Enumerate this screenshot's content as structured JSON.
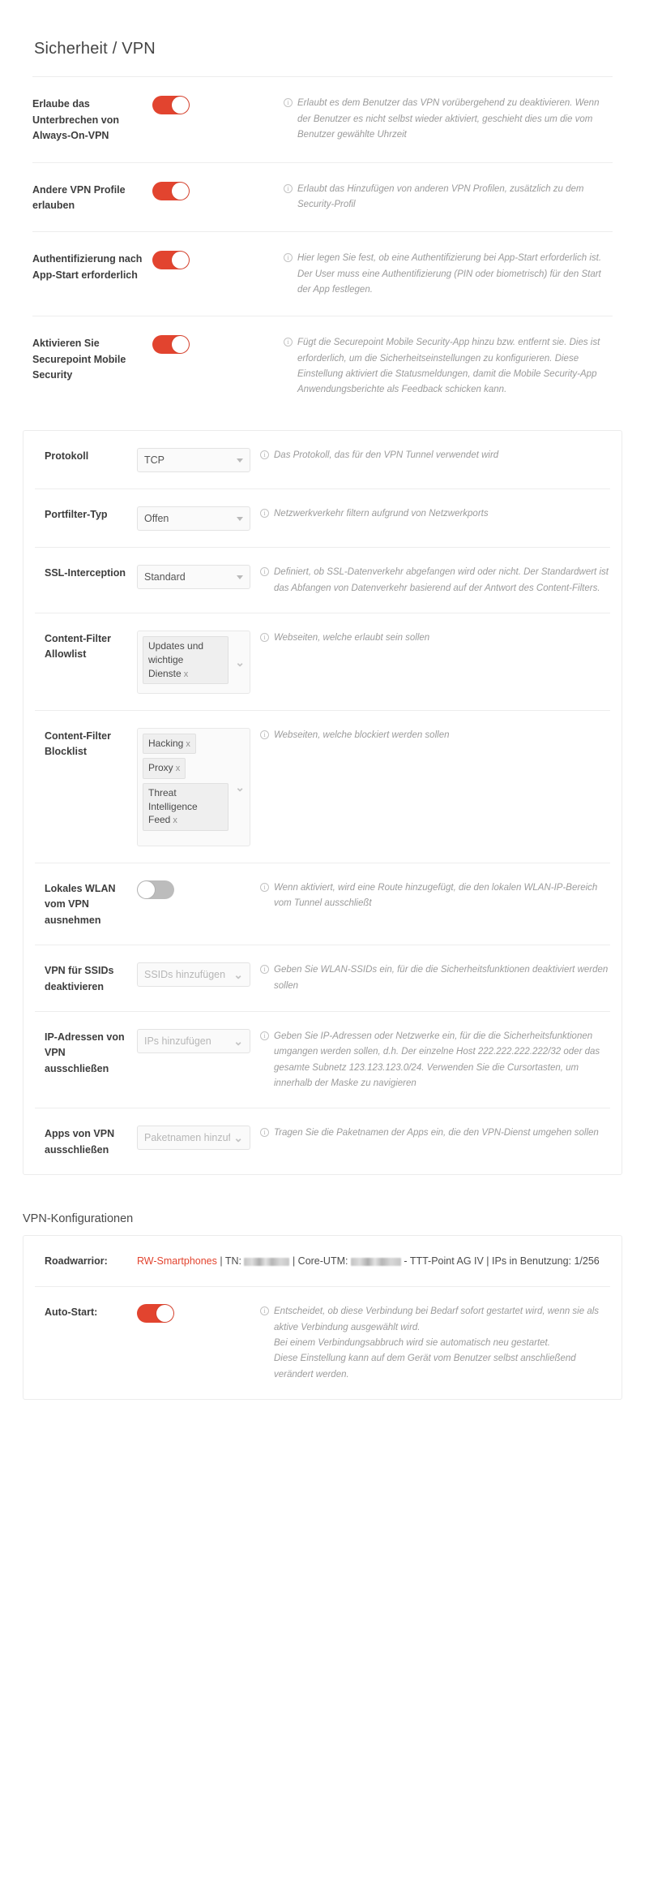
{
  "page": {
    "title": "Sicherheit / VPN"
  },
  "colors": {
    "accent": "#e2442f",
    "toggle_on": "#e2442f",
    "toggle_off": "#bcbcbc",
    "help_text": "#9b9b9b",
    "label_text": "#3d3d3d"
  },
  "toggle_rows": [
    {
      "label": "Erlaube das Unterbrechen von Always-On-VPN",
      "state": "on",
      "help": "Erlaubt es dem Benutzer das VPN vorübergehend zu deaktivieren. Wenn der Benutzer es nicht selbst wieder aktiviert, geschieht dies um die vom Benutzer gewählte Uhrzeit"
    },
    {
      "label": "Andere VPN Profile erlauben",
      "state": "on",
      "help": "Erlaubt das Hinzufügen von anderen VPN Profilen, zusätzlich zu dem Security-Profil"
    },
    {
      "label": "Authentifizierung nach App-Start erforderlich",
      "state": "on",
      "help": "Hier legen Sie fest, ob eine Authentifizierung bei App-Start erforderlich ist. Der User muss eine Authentifizierung (PIN oder biometrisch) für den Start der App festlegen."
    },
    {
      "label": "Aktivieren Sie Securepoint Mobile Security",
      "state": "on",
      "help": "Fügt die Securepoint Mobile Security-App hinzu bzw. entfernt sie. Dies ist erforderlich, um die Sicherheitseinstellungen zu konfigurieren. Diese Einstellung aktiviert die Statusmeldungen, damit die Mobile Security-App Anwendungsberichte als Feedback schicken kann."
    }
  ],
  "settings_card": {
    "protokoll": {
      "label": "Protokoll",
      "value": "TCP",
      "help": "Das Protokoll, das für den VPN Tunnel verwendet wird"
    },
    "portfilter": {
      "label": "Portfilter-Typ",
      "value": "Offen",
      "help": "Netzwerkverkehr filtern aufgrund von Netzwerkports"
    },
    "ssl": {
      "label": "SSL-Interception",
      "value": "Standard",
      "help": "Definiert, ob SSL-Datenverkehr abgefangen wird oder nicht. Der Standardwert ist das Abfangen von Datenverkehr basierend auf der Antwort des Content-Filters."
    },
    "allowlist": {
      "label": "Content-Filter Allowlist",
      "chips": [
        "Updates und wichtige Dienste"
      ],
      "help": "Webseiten, welche erlaubt sein sollen"
    },
    "blocklist": {
      "label": "Content-Filter Blocklist",
      "chips": [
        "Hacking",
        "Proxy",
        "Threat Intelligence Feed"
      ],
      "help": "Webseiten, welche blockiert werden sollen"
    },
    "wlan": {
      "label": "Lokales WLAN vom VPN ausnehmen",
      "state": "off",
      "help": "Wenn aktiviert, wird eine Route hinzugefügt, die den lokalen WLAN-IP-Bereich vom Tunnel ausschließt"
    },
    "ssids": {
      "label": "VPN für SSIDs deaktivieren",
      "placeholder": "SSIDs hinzufügen",
      "help": "Geben Sie WLAN-SSIDs ein, für die die Sicherheitsfunktionen deaktiviert werden sollen"
    },
    "ips": {
      "label": "IP-Adressen von VPN ausschließen",
      "placeholder": "IPs hinzufügen",
      "help": "Geben Sie IP-Adressen oder Netzwerke ein, für die die Sicherheitsfunktionen umgangen werden sollen, d.h. Der einzelne Host 222.222.222.222/32 oder das gesamte Subnetz 123.123.123.0/24. Verwenden Sie die Cursortasten, um innerhalb der Maske zu navigieren"
    },
    "apps": {
      "label": "Apps von VPN ausschließen",
      "placeholder": "Paketnamen hinzufügen",
      "help": "Tragen Sie die Paketnamen der Apps ein, die den VPN-Dienst umgehen sollen"
    }
  },
  "vpn_section": {
    "heading": "VPN-Konfigurationen",
    "roadwarrior": {
      "label": "Roadwarrior:",
      "name": "RW-Smartphones",
      "sep1": " | TN: ",
      "sep2": " | Core-UTM: ",
      "tail": " - TTT-Point AG IV | IPs in Benutzung: 1/256",
      "tn_redacted": true,
      "utm_redacted": true
    },
    "autostart": {
      "label": "Auto-Start:",
      "state": "on",
      "help_lines": [
        "Entscheidet, ob diese Verbindung bei Bedarf sofort gestartet wird, wenn sie als aktive Verbindung ausgewählt wird.",
        "Bei einem Verbindungsabbruch wird sie automatisch neu gestartet.",
        "Diese Einstellung kann auf dem Gerät vom Benutzer selbst anschließend verändert werden."
      ]
    }
  },
  "icons": {
    "info": "i",
    "caret_down": "⌄",
    "chip_remove": "x"
  }
}
